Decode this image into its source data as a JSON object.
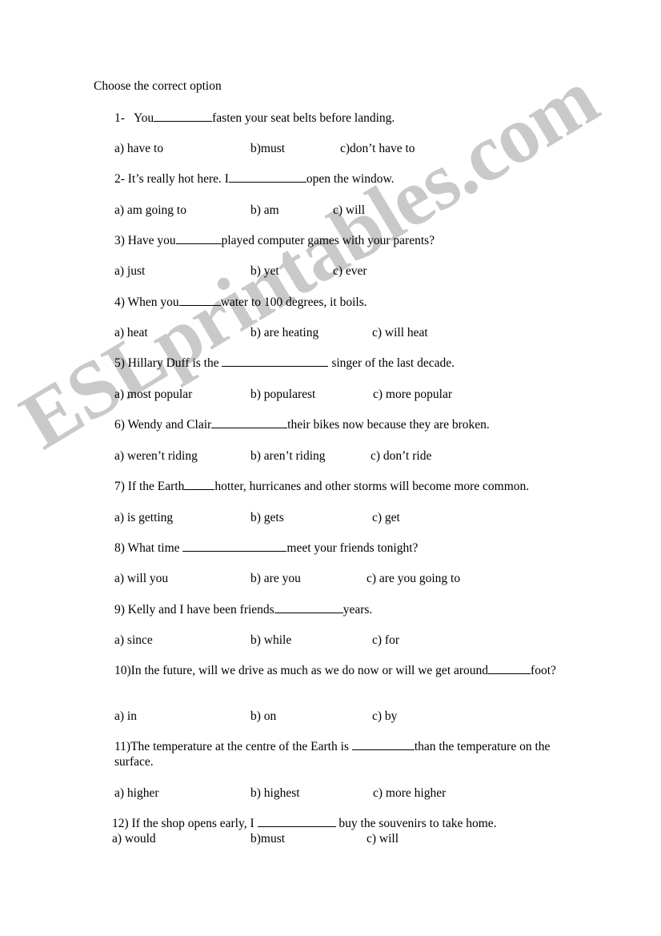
{
  "document": {
    "title": "Choose the correct option",
    "watermark": "ESLprintables.com"
  },
  "questions": [
    {
      "number": "1-",
      "before": "You",
      "after": "fasten your seat belts before landing.",
      "blank_width": 73,
      "options": [
        {
          "label": "a)  have to"
        },
        {
          "label": "b)must"
        },
        {
          "label": "c)don’t have to"
        }
      ]
    },
    {
      "number": "2-",
      "before": "It’s really hot here. I",
      "after": "open the window.",
      "blank_width": 97,
      "options": [
        {
          "label": "a) am going to"
        },
        {
          "label": "b) am"
        },
        {
          "label": "c) will"
        }
      ]
    },
    {
      "number": "3)",
      "before": "Have you",
      "after": "played computer games with your parents?",
      "blank_width": 57,
      "options": [
        {
          "label": "a)  just"
        },
        {
          "label": "b) yet"
        },
        {
          "label": "c) ever"
        }
      ]
    },
    {
      "number": "4)",
      "before": "When you",
      "after": "water to 100 degrees, it boils.",
      "blank_width": 52,
      "options": [
        {
          "label": "a) heat"
        },
        {
          "label": "b) are heating"
        },
        {
          "label": "c) will heat"
        }
      ]
    },
    {
      "number": "5)",
      "before": "Hillary Duff is the ",
      "after": " singer of the last decade.",
      "blank_width": 133,
      "options": [
        {
          "label": "a) most popular"
        },
        {
          "label": "b) popularest"
        },
        {
          "label": "c) more popular"
        }
      ]
    },
    {
      "number": "6)",
      "before": "Wendy and Clair",
      "after": "their bikes now because they are broken.",
      "blank_width": 95,
      "options": [
        {
          "label": "a) weren’t riding"
        },
        {
          "label": "b) aren’t riding"
        },
        {
          "label": "c) don’t ride"
        }
      ]
    },
    {
      "number": "7)",
      "before": "If the Earth",
      "after": "hotter, hurricanes and other storms will become more common.",
      "blank_width": 38,
      "options": [
        {
          "label": "a) is getting"
        },
        {
          "label": "b) gets"
        },
        {
          "label": "c) get"
        }
      ]
    },
    {
      "number": "8)",
      "before": "  What time ",
      "after": "meet your friends tonight?",
      "blank_width": 130,
      "options": [
        {
          "label": "a) will you"
        },
        {
          "label": "b) are you"
        },
        {
          "label": "c) are you going to"
        }
      ]
    },
    {
      "number": "9)",
      "before": "  Kelly and I have been friends",
      "after": "years.",
      "blank_width": 86,
      "options": [
        {
          "label": "a) since"
        },
        {
          "label": "b) while"
        },
        {
          "label": "c) for"
        }
      ]
    },
    {
      "number": "10)",
      "before": "In the future, will we drive as much as we do now or will we get around",
      "after": "foot?",
      "blank_width": 53,
      "options": [
        {
          "label": "a) in"
        },
        {
          "label": "b) on"
        },
        {
          "label": "c) by"
        }
      ]
    },
    {
      "number": "11)",
      "before": "The temperature at the centre of the Earth is ",
      "after": "than the temperature on the surface.",
      "blank_width": 78,
      "options": [
        {
          "label": "a) higher"
        },
        {
          "label": "b) highest"
        },
        {
          "label": "c) more higher"
        }
      ]
    },
    {
      "number": "12)",
      "before": " If the shop opens early, I ",
      "after": " buy the souvenirs to take home.",
      "blank_width": 98,
      "options": [
        {
          "label": "a) would"
        },
        {
          "label": "b)must"
        },
        {
          "label": "c) will"
        }
      ]
    }
  ]
}
